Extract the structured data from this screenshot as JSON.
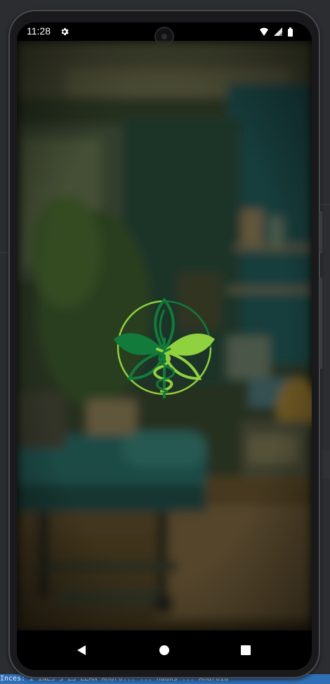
{
  "statusbar": {
    "time": "11:28",
    "icons": [
      "gear-icon",
      "wifi-icon",
      "signal-icon",
      "battery-icon"
    ]
  },
  "splash": {
    "logo": "leaf-caduceus-logo",
    "background": "blurred-clinic-room"
  },
  "navbar": {
    "buttons": [
      "back-icon",
      "home-icon",
      "recents-icon"
    ]
  },
  "ide": {
    "status_text": "Inces: 2  INES  S  ES  LEAN  Andro...  ...  nauks  ...  Android"
  },
  "colors": {
    "logo_dark_green": "#127a3a",
    "logo_light_green": "#8fd13f",
    "screen_overlay": "#1c2418"
  }
}
